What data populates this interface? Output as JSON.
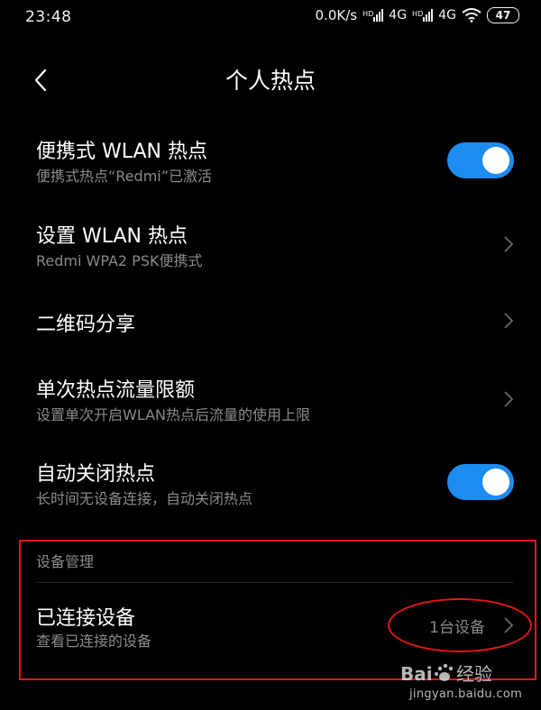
{
  "status_bar": {
    "time": "23:48",
    "net_speed": "0.0K/s",
    "sim1_hd": "HD",
    "sim1_net": "4G",
    "sim2_hd": "HD",
    "sim2_net": "4G",
    "battery": "47"
  },
  "header": {
    "title": "个人热点"
  },
  "settings": {
    "portable_hotspot": {
      "title": "便携式 WLAN 热点",
      "subtitle": "便携式热点“Redmi”已激活",
      "enabled": true
    },
    "configure_hotspot": {
      "title": "设置 WLAN 热点",
      "subtitle": "Redmi WPA2 PSK便携式"
    },
    "qr_share": {
      "title": "二维码分享"
    },
    "data_limit": {
      "title": "单次热点流量限额",
      "subtitle": "设置单次开启WLAN热点后流量的使用上限"
    },
    "auto_off": {
      "title": "自动关闭热点",
      "subtitle": "长时间无设备连接，自动关闭热点",
      "enabled": true
    }
  },
  "device_management": {
    "section_title": "设备管理",
    "connected_devices": {
      "title": "已连接设备",
      "subtitle": "查看已连接的设备",
      "count_label": "1台设备"
    }
  },
  "watermark": {
    "logo_text": "Baidu经验",
    "url": "jingyan.baidu.com"
  },
  "colors": {
    "background": "#000000",
    "accent": "#1c8cf0",
    "secondary_text": "#8a8a8a",
    "annotation": "#e01818"
  }
}
